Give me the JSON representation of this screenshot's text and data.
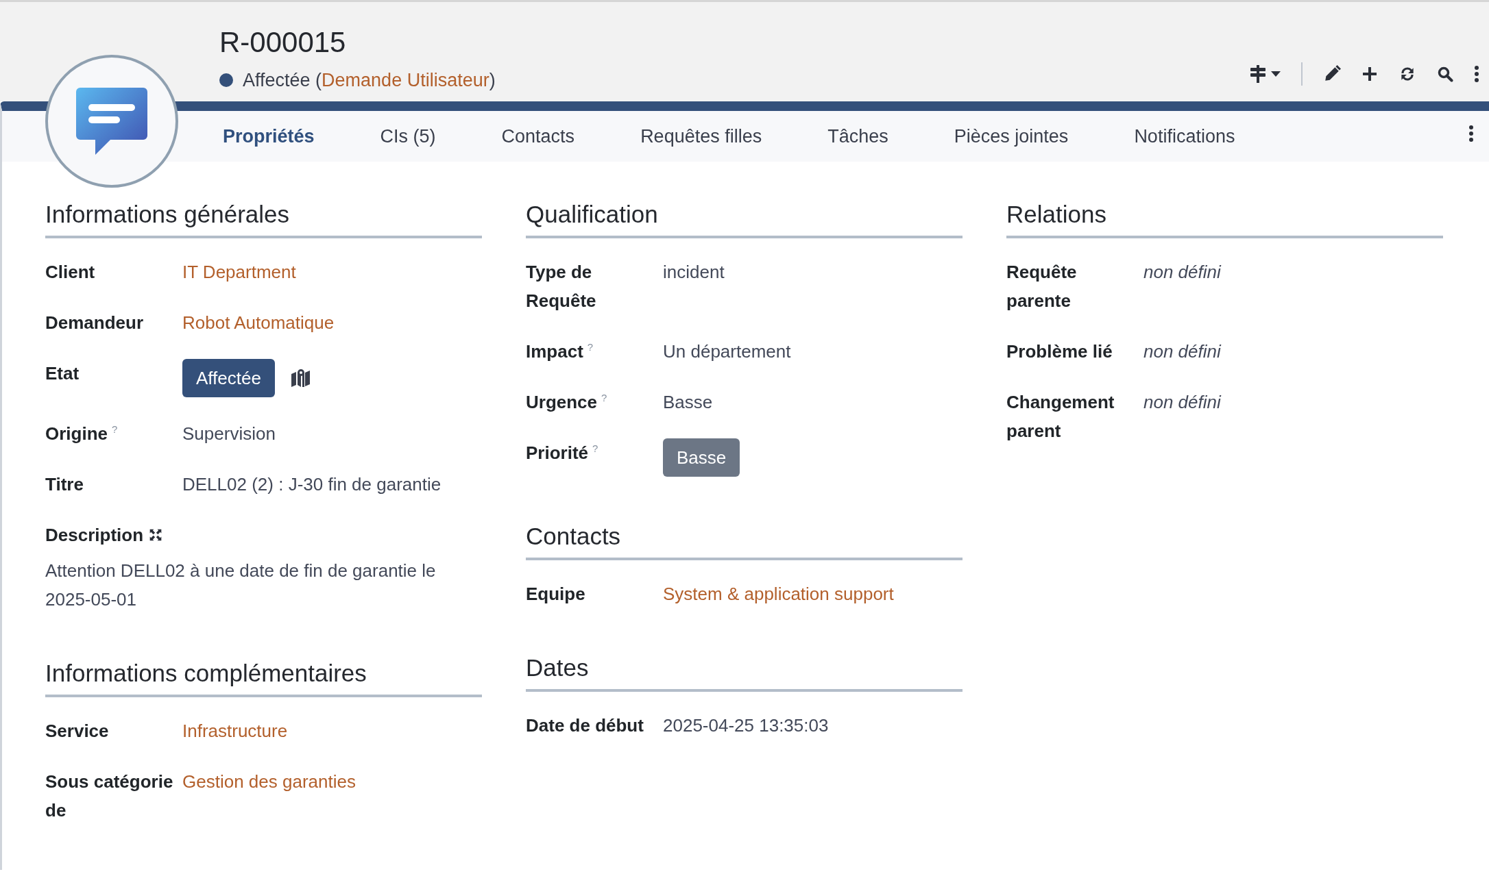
{
  "header": {
    "title": "R-000015",
    "status": {
      "label": "Affectée",
      "color": "#34507a",
      "type_open": "(",
      "type_link": "Demande Utilisateur",
      "type_close": ")"
    }
  },
  "tabs": [
    {
      "label": "Propriétés",
      "selected": true
    },
    {
      "label": "CIs (5)",
      "selected": false
    },
    {
      "label": "Contacts",
      "selected": false
    },
    {
      "label": "Requêtes filles",
      "selected": false
    },
    {
      "label": "Tâches",
      "selected": false
    },
    {
      "label": "Pièces jointes",
      "selected": false
    },
    {
      "label": "Notifications",
      "selected": false
    }
  ],
  "columns": [
    {
      "sections": [
        {
          "title": "Informations générales",
          "rows": [
            {
              "label": "Client",
              "kind": "link",
              "value": "IT Department"
            },
            {
              "label": "Demandeur",
              "kind": "link",
              "value": "Robot Automatique"
            },
            {
              "label": "Etat",
              "kind": "state-button",
              "value": "Affectée"
            },
            {
              "label": "Origine",
              "help_mark": "?",
              "kind": "text",
              "value": "Supervision"
            },
            {
              "label": "Titre",
              "kind": "text",
              "value": "DELL02 (2) : J-30 fin de garantie"
            },
            {
              "label": "Description",
              "kind": "description",
              "value": "Attention DELL02 à une date de fin de garantie le 2025-05-01"
            }
          ]
        },
        {
          "title": "Informations complémentaires",
          "rows": [
            {
              "label": "Service",
              "kind": "link",
              "value": "Infrastructure"
            },
            {
              "label": "Sous catégorie de",
              "kind": "link",
              "value": "Gestion des garanties"
            }
          ]
        }
      ]
    },
    {
      "sections": [
        {
          "title": "Qualification",
          "rows": [
            {
              "label": "Type de Requête",
              "kind": "text",
              "value": "incident"
            },
            {
              "label": "Impact",
              "help_mark": "?",
              "kind": "text",
              "value": "Un département"
            },
            {
              "label": "Urgence",
              "help_mark": "?",
              "kind": "text",
              "value": "Basse"
            },
            {
              "label": "Priorité",
              "help_mark": "?",
              "kind": "priority-badge",
              "value": "Basse"
            }
          ]
        },
        {
          "title": "Contacts",
          "rows": [
            {
              "label": "Equipe",
              "kind": "link",
              "value": "System & application support"
            }
          ]
        },
        {
          "title": "Dates",
          "rows": [
            {
              "label": "Date de début",
              "kind": "text",
              "value": "2025-04-25 13:35:03"
            }
          ]
        }
      ]
    },
    {
      "sections": [
        {
          "title": "Relations",
          "rows": [
            {
              "label": "Requête parente",
              "kind": "undefined",
              "value": "non défini"
            },
            {
              "label": "Problème lié",
              "kind": "undefined",
              "value": "non défini"
            },
            {
              "label": "Changement parent",
              "kind": "undefined",
              "value": "non défini"
            }
          ]
        }
      ]
    }
  ]
}
